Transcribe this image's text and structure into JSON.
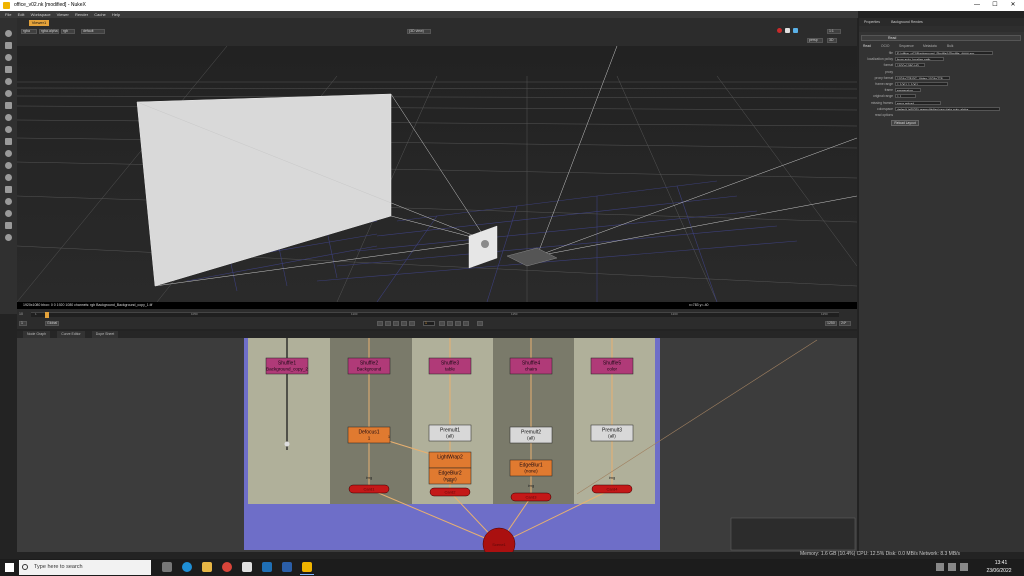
{
  "window": {
    "title": "office_v02.nk [modified] - NukeX",
    "minimize": "—",
    "maximize": "☐",
    "close": "✕"
  },
  "menu": [
    "File",
    "Edit",
    "Workspace",
    "Viewer",
    "Render",
    "Cache",
    "Help"
  ],
  "viewer": {
    "tab_label": "Viewer1",
    "channel": "rgba",
    "channel2": "rgba.alpha",
    "layer": "rgb",
    "cam_mode": "default",
    "camera_label": "(3D view)",
    "zoom": "1:1",
    "view_mode": "persp",
    "proxy": "3D",
    "info_text": "1920x1080  bbox: 0 0 1920 1080  channels: rgb  Background_Background_copy_1.tif",
    "info_right": "x=783 y=-40",
    "fps_label": "10",
    "frame": "1",
    "tl_ticks": [
      "1",
      "1050",
      "1100",
      "1150",
      "1200",
      "1250"
    ],
    "tl_end": "1250",
    "playback_mode": "Global",
    "fps_value": "24*"
  },
  "panel_tabs": [
    "Node Graph",
    "Curve Editor",
    "Dope Sheet"
  ],
  "nodes": [
    {
      "name": "Shuffle1",
      "sub": "Background_copy_2",
      "color": "#b03a78"
    },
    {
      "name": "Shuffle2",
      "sub": "Background",
      "color": "#b03a78"
    },
    {
      "name": "Shuffle3",
      "sub": "table",
      "color": "#b03a78"
    },
    {
      "name": "Shuffle4",
      "sub": "chairs",
      "color": "#b03a78"
    },
    {
      "name": "Shuffle5",
      "sub": "color",
      "color": "#b03a78"
    },
    {
      "name": "Defocus1",
      "sub": "1",
      "color": "#e07a30"
    },
    {
      "name": "Premult1",
      "sub": "(all)",
      "color": "#d8d8d8"
    },
    {
      "name": "Premult2",
      "sub": "(all)",
      "color": "#d8d8d8"
    },
    {
      "name": "Premult3",
      "sub": "(all)",
      "color": "#d8d8d8"
    },
    {
      "name": "LightWrap2",
      "sub": "",
      "color": "#e07a30"
    },
    {
      "name": "EdgeBlur2",
      "sub": "(none)",
      "color": "#e07a30"
    },
    {
      "name": "EdgeBlur1",
      "sub": "(none)",
      "color": "#e07a30"
    },
    {
      "name": "Card1",
      "sub": "img",
      "color": "#c41818"
    },
    {
      "name": "Card2",
      "sub": "img",
      "color": "#c41818"
    },
    {
      "name": "Card3",
      "sub": "img",
      "color": "#c41818"
    },
    {
      "name": "Card4",
      "sub": "img",
      "color": "#c41818"
    },
    {
      "name": "Scene1",
      "sub": "",
      "color": "#aa1010"
    }
  ],
  "dag_labels": {
    "dot1": "1"
  },
  "props": {
    "tabs": [
      "Properties",
      "Background Rendes"
    ],
    "node_title": "Read",
    "node_tabs": [
      "Read",
      "OCIO",
      "Sequence",
      "Metadata",
      "Bulk"
    ],
    "rows": [
      {
        "label": "file",
        "value": "E:/office_v02/Background_Shuffle1/Shuffle_####.exr"
      },
      {
        "label": "localization policy",
        "value": "from auto-localize path"
      },
      {
        "label": "format",
        "value": "1920x1080 HD"
      },
      {
        "label": "proxy",
        "value": ""
      },
      {
        "label": "proxy format",
        "value": "1024x778 PC_Video 1024x778"
      },
      {
        "label": "frame range",
        "value": "1     1001     1     1001"
      },
      {
        "label": "frame",
        "value": "expression"
      },
      {
        "label": "original range",
        "value": "1     1"
      },
      {
        "label": "missing frames",
        "value": "error          reload"
      },
      {
        "label": "colorspace",
        "value": "default (sRGB)   premultiplied   raw data   auto alpha"
      },
      {
        "label": "read options",
        "value": ""
      }
    ],
    "button": "Reload Layout"
  },
  "status": "Memory: 1.6 GB (10.4%) CPU: 12.5% Disk: 0.0 MB/s Network: 8.3 MB/s",
  "taskbar": {
    "search_placeholder": "Type here to search",
    "time": "13:41",
    "date": "23/06/2022"
  }
}
